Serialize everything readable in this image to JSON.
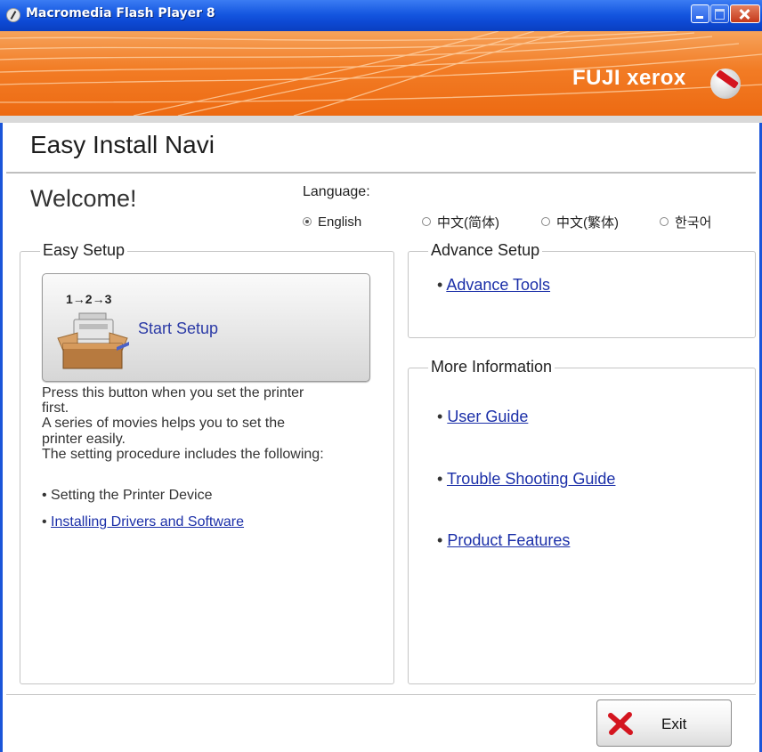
{
  "window": {
    "title": "Macromedia Flash Player 8"
  },
  "banner": {
    "brand": "FUJI xerox"
  },
  "app": {
    "title": "Easy Install Navi",
    "welcome": "Welcome!"
  },
  "language": {
    "label": "Language:",
    "options": [
      {
        "label": "English",
        "selected": true
      },
      {
        "label": "中文(简体)",
        "selected": false
      },
      {
        "label": "中文(繁体)",
        "selected": false
      },
      {
        "label": "한국어",
        "selected": false
      }
    ]
  },
  "easy_setup": {
    "title": "Easy Setup",
    "button_steps": "1→2→3",
    "button_label": "Start Setup",
    "description": [
      "Press this button when you set the printer",
      "first.",
      "A series of movies helps you to set the",
      "printer easily.",
      "The setting procedure includes the following:"
    ],
    "items": [
      {
        "text": "Setting the Printer Device",
        "link": false
      },
      {
        "text": "Installing Drivers and Software",
        "link": true
      }
    ]
  },
  "advance_setup": {
    "title": "Advance Setup",
    "links": [
      "Advance Tools"
    ]
  },
  "more_information": {
    "title": "More Information",
    "links": [
      "User Guide ",
      "Trouble Shooting Guide",
      "Product Features"
    ]
  },
  "footer": {
    "exit_label": "Exit"
  },
  "colors": {
    "titlebar": "#0d49d4",
    "banner": "#f27c25",
    "link": "#1b2fa8",
    "exit_x": "#d4151f"
  }
}
